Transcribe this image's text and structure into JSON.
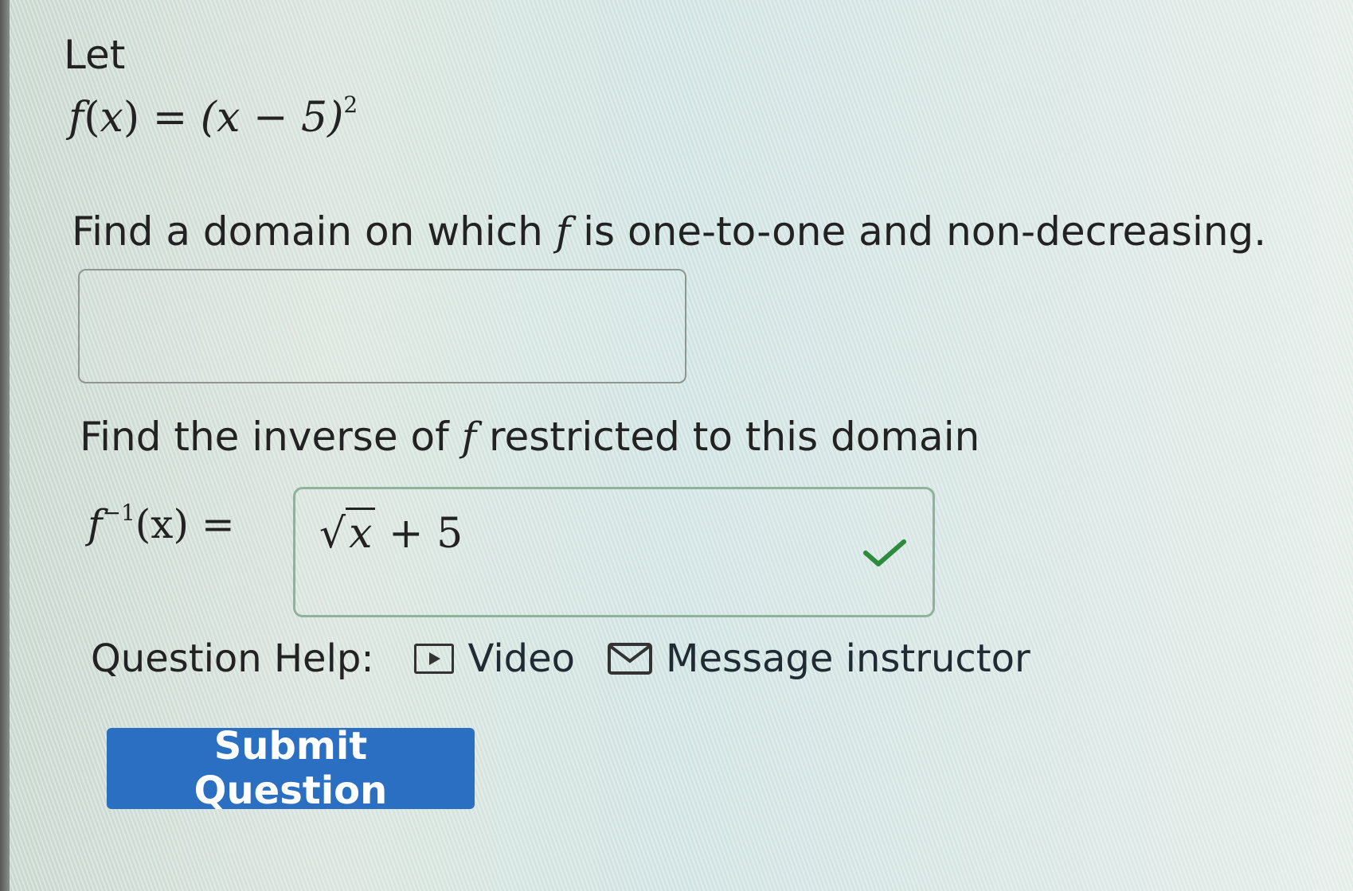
{
  "problem": {
    "intro": "Let",
    "function": {
      "name": "f",
      "var": "x",
      "expression": "(x − 5)",
      "exponent": "2"
    },
    "question_domain": {
      "before": "Find a domain on which ",
      "symbol": "f",
      "after": " is one-to-one and non-decreasing."
    },
    "domain_answer": "",
    "question_inverse": {
      "before": "Find the inverse of ",
      "symbol": "f",
      "after": " restricted to this domain"
    },
    "inverse_label": {
      "name": "f",
      "exponent": "−1",
      "arg": "(x) ="
    },
    "inverse_answer": {
      "radical": "√",
      "radicand": "x",
      "rest": "+ 5",
      "status": "correct"
    }
  },
  "help": {
    "label": "Question Help:",
    "video_label": "Video",
    "message_label": "Message instructor"
  },
  "submit_label": "Submit Question",
  "colors": {
    "submit_button": "#2a6fc1",
    "check": "#2e8b3e",
    "correct_border": "#8fb29a"
  },
  "icons": {
    "video": "video-play-icon",
    "message": "envelope-icon",
    "status": "checkmark-icon"
  }
}
